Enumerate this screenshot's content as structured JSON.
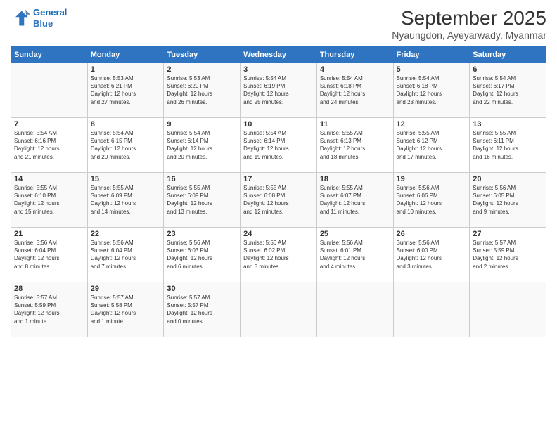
{
  "header": {
    "logo_line1": "General",
    "logo_line2": "Blue",
    "main_title": "September 2025",
    "subtitle": "Nyaungdon, Ayeyarwady, Myanmar"
  },
  "days_of_week": [
    "Sunday",
    "Monday",
    "Tuesday",
    "Wednesday",
    "Thursday",
    "Friday",
    "Saturday"
  ],
  "weeks": [
    [
      {
        "num": "",
        "info": ""
      },
      {
        "num": "1",
        "info": "Sunrise: 5:53 AM\nSunset: 6:21 PM\nDaylight: 12 hours\nand 27 minutes."
      },
      {
        "num": "2",
        "info": "Sunrise: 5:53 AM\nSunset: 6:20 PM\nDaylight: 12 hours\nand 26 minutes."
      },
      {
        "num": "3",
        "info": "Sunrise: 5:54 AM\nSunset: 6:19 PM\nDaylight: 12 hours\nand 25 minutes."
      },
      {
        "num": "4",
        "info": "Sunrise: 5:54 AM\nSunset: 6:18 PM\nDaylight: 12 hours\nand 24 minutes."
      },
      {
        "num": "5",
        "info": "Sunrise: 5:54 AM\nSunset: 6:18 PM\nDaylight: 12 hours\nand 23 minutes."
      },
      {
        "num": "6",
        "info": "Sunrise: 5:54 AM\nSunset: 6:17 PM\nDaylight: 12 hours\nand 22 minutes."
      }
    ],
    [
      {
        "num": "7",
        "info": "Sunrise: 5:54 AM\nSunset: 6:16 PM\nDaylight: 12 hours\nand 21 minutes."
      },
      {
        "num": "8",
        "info": "Sunrise: 5:54 AM\nSunset: 6:15 PM\nDaylight: 12 hours\nand 20 minutes."
      },
      {
        "num": "9",
        "info": "Sunrise: 5:54 AM\nSunset: 6:14 PM\nDaylight: 12 hours\nand 20 minutes."
      },
      {
        "num": "10",
        "info": "Sunrise: 5:54 AM\nSunset: 6:14 PM\nDaylight: 12 hours\nand 19 minutes."
      },
      {
        "num": "11",
        "info": "Sunrise: 5:55 AM\nSunset: 6:13 PM\nDaylight: 12 hours\nand 18 minutes."
      },
      {
        "num": "12",
        "info": "Sunrise: 5:55 AM\nSunset: 6:12 PM\nDaylight: 12 hours\nand 17 minutes."
      },
      {
        "num": "13",
        "info": "Sunrise: 5:55 AM\nSunset: 6:11 PM\nDaylight: 12 hours\nand 16 minutes."
      }
    ],
    [
      {
        "num": "14",
        "info": "Sunrise: 5:55 AM\nSunset: 6:10 PM\nDaylight: 12 hours\nand 15 minutes."
      },
      {
        "num": "15",
        "info": "Sunrise: 5:55 AM\nSunset: 6:09 PM\nDaylight: 12 hours\nand 14 minutes."
      },
      {
        "num": "16",
        "info": "Sunrise: 5:55 AM\nSunset: 6:09 PM\nDaylight: 12 hours\nand 13 minutes."
      },
      {
        "num": "17",
        "info": "Sunrise: 5:55 AM\nSunset: 6:08 PM\nDaylight: 12 hours\nand 12 minutes."
      },
      {
        "num": "18",
        "info": "Sunrise: 5:55 AM\nSunset: 6:07 PM\nDaylight: 12 hours\nand 11 minutes."
      },
      {
        "num": "19",
        "info": "Sunrise: 5:56 AM\nSunset: 6:06 PM\nDaylight: 12 hours\nand 10 minutes."
      },
      {
        "num": "20",
        "info": "Sunrise: 5:56 AM\nSunset: 6:05 PM\nDaylight: 12 hours\nand 9 minutes."
      }
    ],
    [
      {
        "num": "21",
        "info": "Sunrise: 5:56 AM\nSunset: 6:04 PM\nDaylight: 12 hours\nand 8 minutes."
      },
      {
        "num": "22",
        "info": "Sunrise: 5:56 AM\nSunset: 6:04 PM\nDaylight: 12 hours\nand 7 minutes."
      },
      {
        "num": "23",
        "info": "Sunrise: 5:56 AM\nSunset: 6:03 PM\nDaylight: 12 hours\nand 6 minutes."
      },
      {
        "num": "24",
        "info": "Sunrise: 5:56 AM\nSunset: 6:02 PM\nDaylight: 12 hours\nand 5 minutes."
      },
      {
        "num": "25",
        "info": "Sunrise: 5:56 AM\nSunset: 6:01 PM\nDaylight: 12 hours\nand 4 minutes."
      },
      {
        "num": "26",
        "info": "Sunrise: 5:56 AM\nSunset: 6:00 PM\nDaylight: 12 hours\nand 3 minutes."
      },
      {
        "num": "27",
        "info": "Sunrise: 5:57 AM\nSunset: 5:59 PM\nDaylight: 12 hours\nand 2 minutes."
      }
    ],
    [
      {
        "num": "28",
        "info": "Sunrise: 5:57 AM\nSunset: 5:59 PM\nDaylight: 12 hours\nand 1 minute."
      },
      {
        "num": "29",
        "info": "Sunrise: 5:57 AM\nSunset: 5:58 PM\nDaylight: 12 hours\nand 1 minute."
      },
      {
        "num": "30",
        "info": "Sunrise: 5:57 AM\nSunset: 5:57 PM\nDaylight: 12 hours\nand 0 minutes."
      },
      {
        "num": "",
        "info": ""
      },
      {
        "num": "",
        "info": ""
      },
      {
        "num": "",
        "info": ""
      },
      {
        "num": "",
        "info": ""
      }
    ]
  ]
}
